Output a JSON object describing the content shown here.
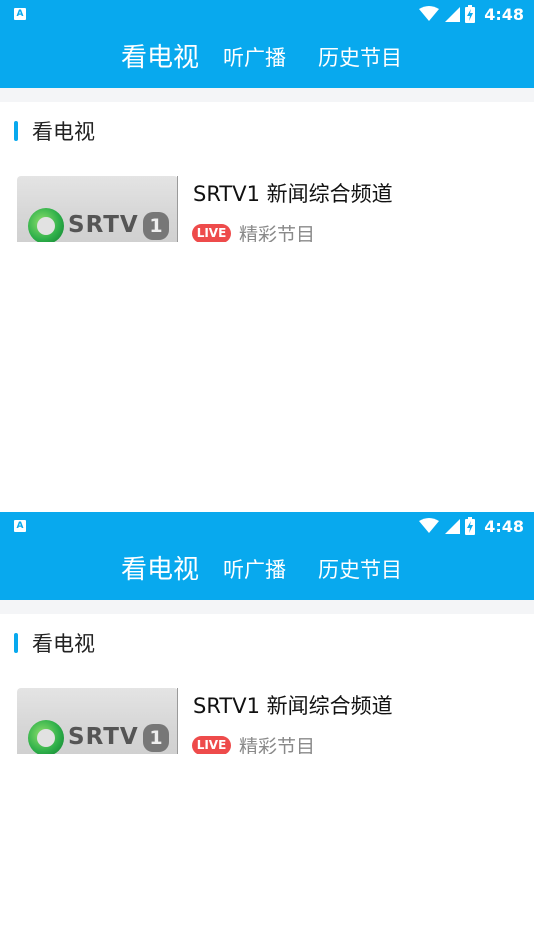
{
  "status_bar": {
    "notification_label": "A",
    "time": "4:48",
    "icons": [
      "wifi-icon",
      "cellular-signal-icon",
      "battery-charging-icon"
    ]
  },
  "tabs": [
    {
      "label": "看电视",
      "active": true
    },
    {
      "label": "听广播",
      "active": false
    },
    {
      "label": "历史节目",
      "active": false
    }
  ],
  "section": {
    "title": "看电视"
  },
  "channels": [
    {
      "name": "SRTV1 新闻综合频道",
      "badge": "LIVE",
      "subtitle": "精彩节目",
      "logo_text": "SRTV",
      "logo_number": "1"
    }
  ],
  "colors": {
    "accent": "#08a9ee",
    "live_badge": "#ee4b4b",
    "background": "#ffffff",
    "divider_gap": "#f4f5f7"
  }
}
